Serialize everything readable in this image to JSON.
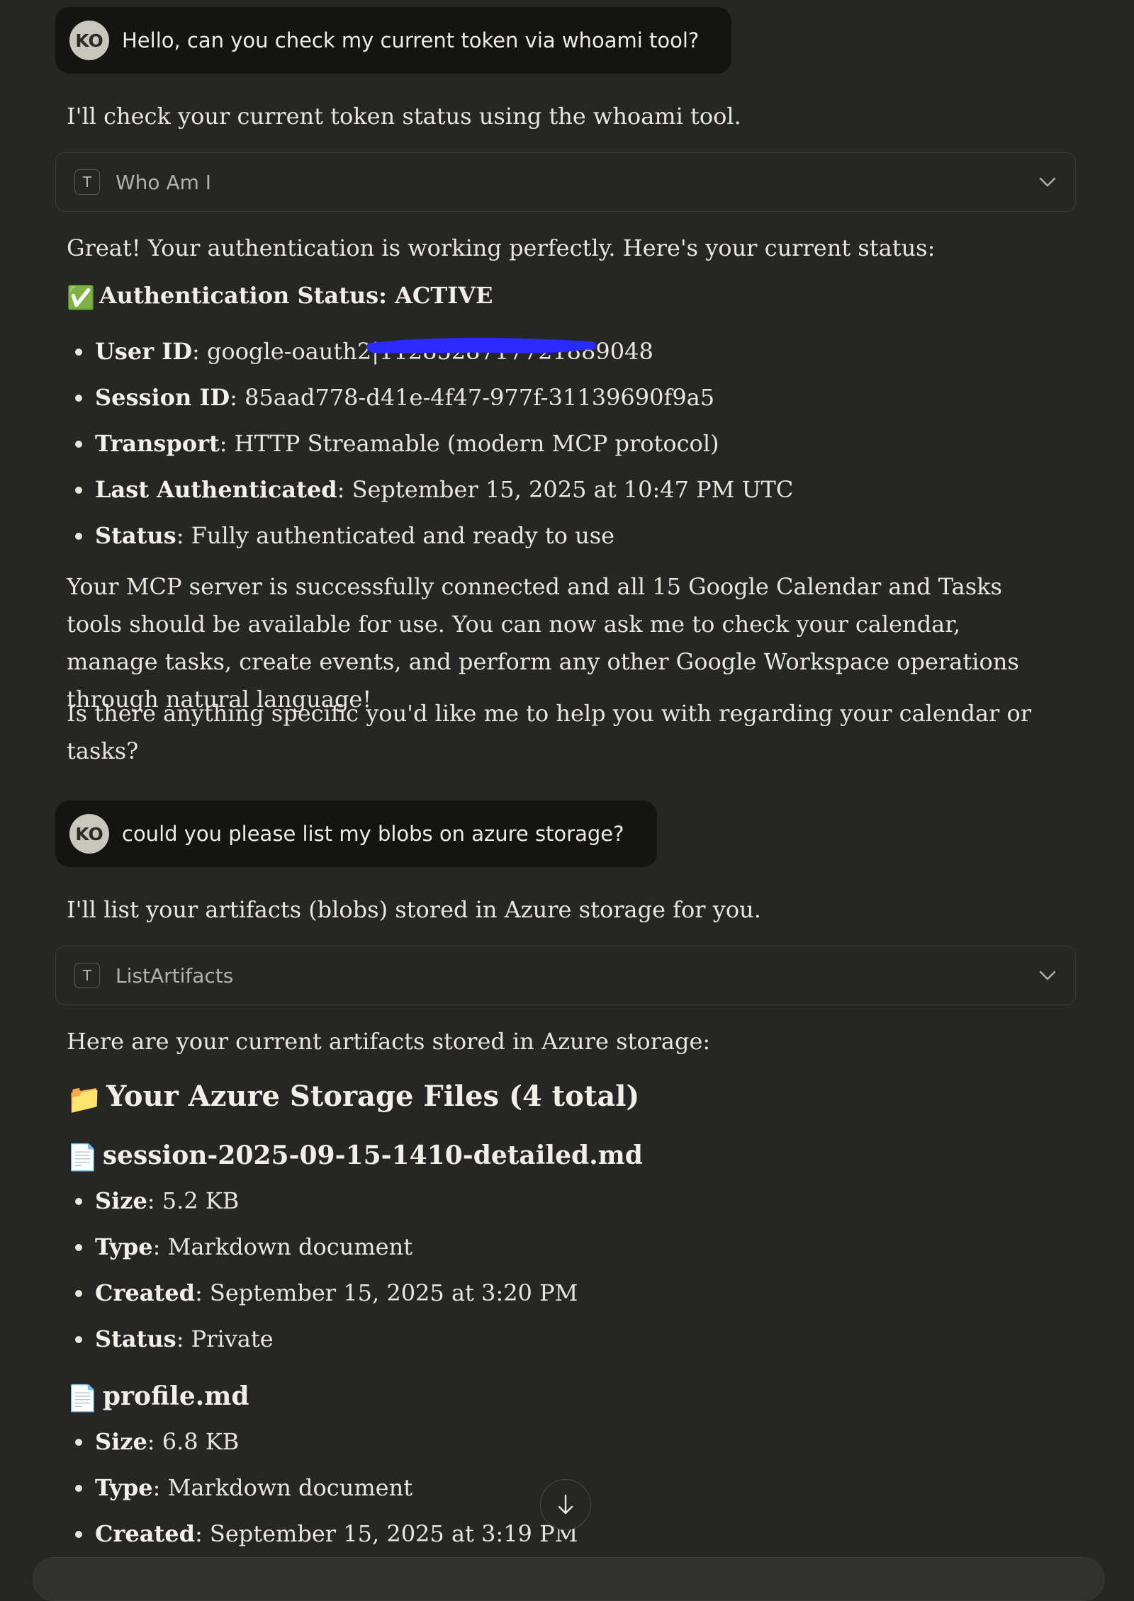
{
  "messages": [
    {
      "user": {
        "avatar": "KO",
        "text": "Hello, can you check my current token via whoami tool?"
      },
      "assistant_intro": "I'll check your current token status using the whoami tool.",
      "tool": {
        "badge": "T",
        "name": "Who Am I"
      },
      "response_intro": "Great! Your authentication is working perfectly. Here's your current status:",
      "status_heading": {
        "emoji": "✅",
        "text": "Authentication Status: ACTIVE"
      },
      "details": [
        {
          "label": "User ID",
          "value": ": google-oauth2|1128528717721889048"
        },
        {
          "label": "Session ID",
          "value": ": 85aad778-d41e-4f47-977f-31139690f9a5"
        },
        {
          "label": "Transport",
          "value": ": HTTP Streamable (modern MCP protocol)"
        },
        {
          "label": "Last Authenticated",
          "value": ": September 15, 2025 at 10:47 PM UTC"
        },
        {
          "label": "Status",
          "value": ": Fully authenticated and ready to use"
        }
      ],
      "paragraph": "Your MCP server is successfully connected and all 15 Google Calendar and Tasks tools should be available for use. You can now ask me to check your calendar, manage tasks, create events, and perform any other Google Workspace operations through natural language!",
      "question": "Is there anything specific you'd like me to help you with regarding your calendar or tasks?"
    },
    {
      "user": {
        "avatar": "KO",
        "text": "could you please list my blobs on azure storage?"
      },
      "assistant_intro": "I'll list your artifacts (blobs) stored in Azure storage for you.",
      "tool": {
        "badge": "T",
        "name": "ListArtifacts"
      },
      "response_intro": "Here are your current artifacts stored in Azure storage:",
      "section_heading": {
        "emoji": "📁",
        "text": "Your Azure Storage Files (4 total)"
      },
      "files": [
        {
          "emoji": "📄",
          "name": "session-2025-09-15-1410-detailed.md",
          "props": [
            {
              "label": "Size",
              "value": ": 5.2 KB"
            },
            {
              "label": "Type",
              "value": ": Markdown document"
            },
            {
              "label": "Created",
              "value": ": September 15, 2025 at 3:20 PM"
            },
            {
              "label": "Status",
              "value": ": Private"
            }
          ]
        },
        {
          "emoji": "📄",
          "name": "profile.md",
          "props": [
            {
              "label": "Size",
              "value": ": 6.8 KB"
            },
            {
              "label": "Type",
              "value": ": Markdown document"
            },
            {
              "label": "Created",
              "value": ": September 15, 2025 at 3:19 PM"
            }
          ]
        }
      ]
    }
  ],
  "colors": {
    "background": "#262624",
    "user_bubble": "#141413",
    "text": "#e9e6dd",
    "redaction": "#2b2bff"
  },
  "icons": {
    "tool": "tool-letter-icon",
    "expand": "chevron-down-icon",
    "scroll": "arrow-down-icon"
  }
}
